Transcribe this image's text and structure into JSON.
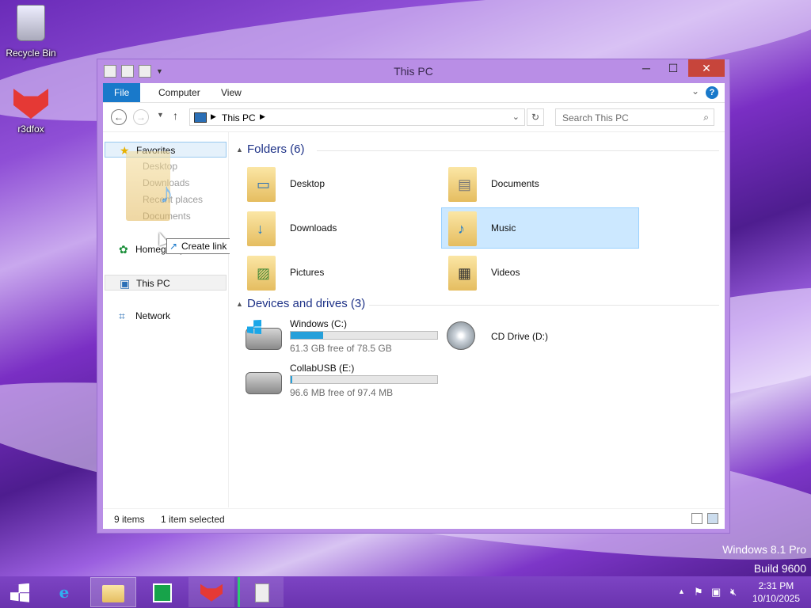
{
  "desktop": {
    "icons": [
      {
        "label": "Recycle Bin",
        "icon": "recycle-bin-icon"
      },
      {
        "label": "r3dfox",
        "icon": "r3dfox-icon"
      }
    ],
    "watermark_line1": "Windows 8.1 Pro",
    "watermark_line2": "Build 9600"
  },
  "window": {
    "title": "This PC",
    "minimize": "─",
    "maximize": "☐",
    "close": "✕",
    "ribbon_tabs": [
      "File",
      "Computer",
      "View"
    ],
    "address": "This PC",
    "search_placeholder": "Search This PC",
    "nav": {
      "favorites": "Favorites",
      "favorites_children": [
        "Desktop",
        "Downloads",
        "Recent places",
        "Documents"
      ],
      "homegroup": "Homegroup",
      "this_pc": "This PC",
      "network": "Network"
    },
    "drag_tooltip": "Create link in Favorites",
    "groups": {
      "folders_header": "Folders (6)",
      "devices_header": "Devices and drives (3)"
    },
    "folders": [
      {
        "label": "Desktop",
        "icon": "desktop-folder-icon"
      },
      {
        "label": "Documents",
        "icon": "documents-folder-icon"
      },
      {
        "label": "Downloads",
        "icon": "downloads-folder-icon"
      },
      {
        "label": "Music",
        "icon": "music-folder-icon",
        "selected": true
      },
      {
        "label": "Pictures",
        "icon": "pictures-folder-icon"
      },
      {
        "label": "Videos",
        "icon": "videos-folder-icon"
      }
    ],
    "drives": [
      {
        "label": "Windows (C:)",
        "free": "61.3 GB free of 78.5 GB",
        "used_fraction": 0.22
      },
      {
        "label": "CD Drive (D:)"
      },
      {
        "label": "CollabUSB (E:)",
        "free": "96.6 MB free of 97.4 MB",
        "used_fraction": 0.01
      }
    ],
    "status": {
      "count": "9 items",
      "selected": "1 item selected"
    }
  },
  "taskbar": {
    "time": "2:31 PM",
    "date": "10/10/2025",
    "buttons": [
      "start-icon",
      "internet-explorer-icon",
      "file-explorer-icon",
      "store-icon",
      "r3dfox-icon",
      "app-icon"
    ]
  },
  "colors": {
    "accent": "#1979ca",
    "selection": "#cce8ff",
    "close": "#c7453b",
    "taskbar": "#7d44c4",
    "drive_fill": "#26a0da"
  }
}
